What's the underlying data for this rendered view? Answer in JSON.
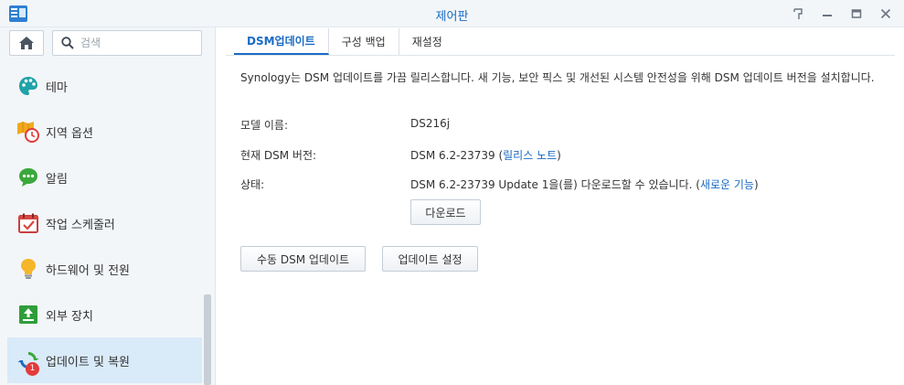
{
  "window": {
    "title": "제어판",
    "buttons": {
      "pin": "pin-icon",
      "minimize": "minimize-icon",
      "maximize": "maximize-icon",
      "close": "close-icon"
    }
  },
  "sidebar": {
    "search_placeholder": "검색",
    "items": [
      {
        "label": "테마",
        "icon": "palette-icon"
      },
      {
        "label": "지역 옵션",
        "icon": "region-clock-icon"
      },
      {
        "label": "알림",
        "icon": "chat-bubble-icon"
      },
      {
        "label": "작업 스케줄러",
        "icon": "calendar-check-icon"
      },
      {
        "label": "하드웨어 및 전원",
        "icon": "lightbulb-icon"
      },
      {
        "label": "외부 장치",
        "icon": "external-device-icon"
      },
      {
        "label": "업데이트 및 복원",
        "icon": "update-restore-icon",
        "badge": "1",
        "active": true
      }
    ]
  },
  "tabs": [
    {
      "label": "DSM업데이트",
      "active": true
    },
    {
      "label": "구성 백업"
    },
    {
      "label": "재설정"
    }
  ],
  "content": {
    "description": "Synology는 DSM 업데이트를 가끔 릴리스합니다. 새 기능, 보안 픽스 및 개선된 시스템 안전성을 위해 DSM 업데이트 버전을 설치합니다.",
    "model_label": "모델 이름:",
    "model_value": "DS216j",
    "version_label": "현재 DSM 버전:",
    "version_value": "DSM 6.2-23739",
    "release_notes": "릴리스 노트",
    "status_label": "상태:",
    "status_value": "DSM 6.2-23739 Update 1을(를) 다운로드할 수 있습니다.",
    "new_features": "새로운 기능",
    "download_button": "다운로드",
    "manual_update_button": "수동 DSM 업데이트",
    "update_settings_button": "업데이트 설정"
  },
  "colors": {
    "accent": "#1a6bc4",
    "status_green": "#2e9e3a",
    "badge_red": "#e43a3a"
  }
}
